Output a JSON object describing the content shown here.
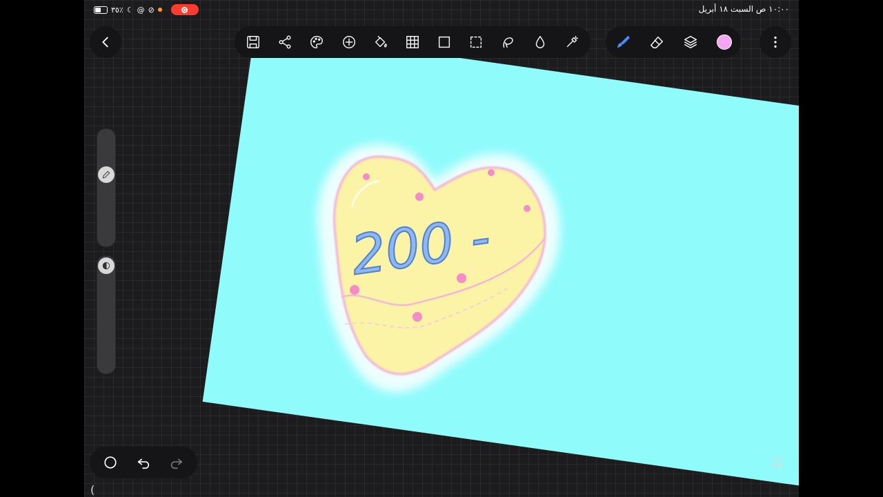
{
  "status_bar": {
    "battery_percent": "٣٥٪",
    "datetime": "١٠:٠٠ ص   السبت ١٨ أبريل"
  },
  "canvas": {
    "background_color": "#8ffbfb",
    "artwork_text": "200 -"
  },
  "toolbar": {
    "icons": [
      "save-icon",
      "share-icon",
      "palette-icon",
      "add-icon",
      "fill-bucket-icon",
      "grid-icon",
      "transform-icon",
      "selection-icon",
      "lasso-icon",
      "liquify-icon",
      "magic-icon"
    ]
  },
  "right_tools": {
    "icons": [
      "brush-icon",
      "eraser-icon",
      "layers-icon",
      "color-swatch"
    ],
    "active_color": "#f5a6f2"
  },
  "colors": {
    "app_background": "#1c1c1e",
    "toolbar_background": "#151517",
    "record_red": "#ff3b30"
  }
}
